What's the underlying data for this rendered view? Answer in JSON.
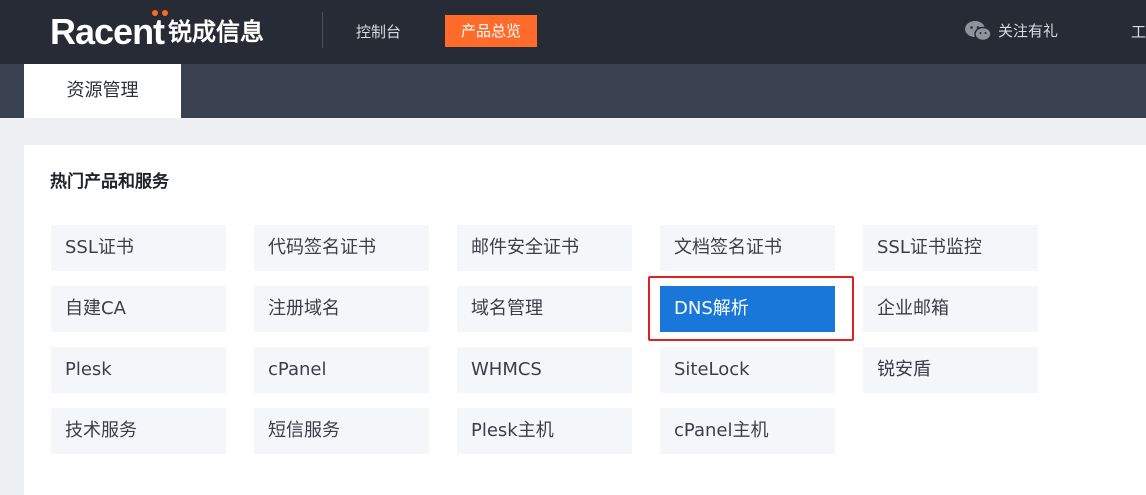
{
  "header": {
    "logo_text": "Racent",
    "logo_cn": "锐成信息",
    "nav_console": "控制台",
    "nav_overview": "产品总览",
    "follow_label": "关注有礼",
    "nav_truncated": "工"
  },
  "subnav": {
    "active_tab": "资源管理"
  },
  "section": {
    "title": "热门产品和服务"
  },
  "products": [
    {
      "label": "SSL证书",
      "id": "ssl-cert"
    },
    {
      "label": "代码签名证书",
      "id": "code-signing-cert"
    },
    {
      "label": "邮件安全证书",
      "id": "email-security-cert"
    },
    {
      "label": "文档签名证书",
      "id": "document-signing-cert"
    },
    {
      "label": "SSL证书监控",
      "id": "ssl-cert-monitor"
    },
    {
      "label": "自建CA",
      "id": "private-ca"
    },
    {
      "label": "注册域名",
      "id": "register-domain"
    },
    {
      "label": "域名管理",
      "id": "domain-management"
    },
    {
      "label": "DNS解析",
      "id": "dns-resolution",
      "active": true
    },
    {
      "label": "企业邮箱",
      "id": "enterprise-email"
    },
    {
      "label": "Plesk",
      "id": "plesk"
    },
    {
      "label": "cPanel",
      "id": "cpanel"
    },
    {
      "label": "WHMCS",
      "id": "whmcs"
    },
    {
      "label": "SiteLock",
      "id": "sitelock"
    },
    {
      "label": "锐安盾",
      "id": "ruiandun"
    },
    {
      "label": "技术服务",
      "id": "technical-service"
    },
    {
      "label": "短信服务",
      "id": "sms-service"
    },
    {
      "label": "Plesk主机",
      "id": "plesk-hosting"
    },
    {
      "label": "cPanel主机",
      "id": "cpanel-hosting"
    }
  ],
  "colors": {
    "topbar": "#262b35",
    "accent_orange": "#ff6b2b",
    "active_blue": "#1877d8",
    "highlight_red": "#e0201c"
  },
  "icons": {
    "follow": "wechat-icon"
  }
}
